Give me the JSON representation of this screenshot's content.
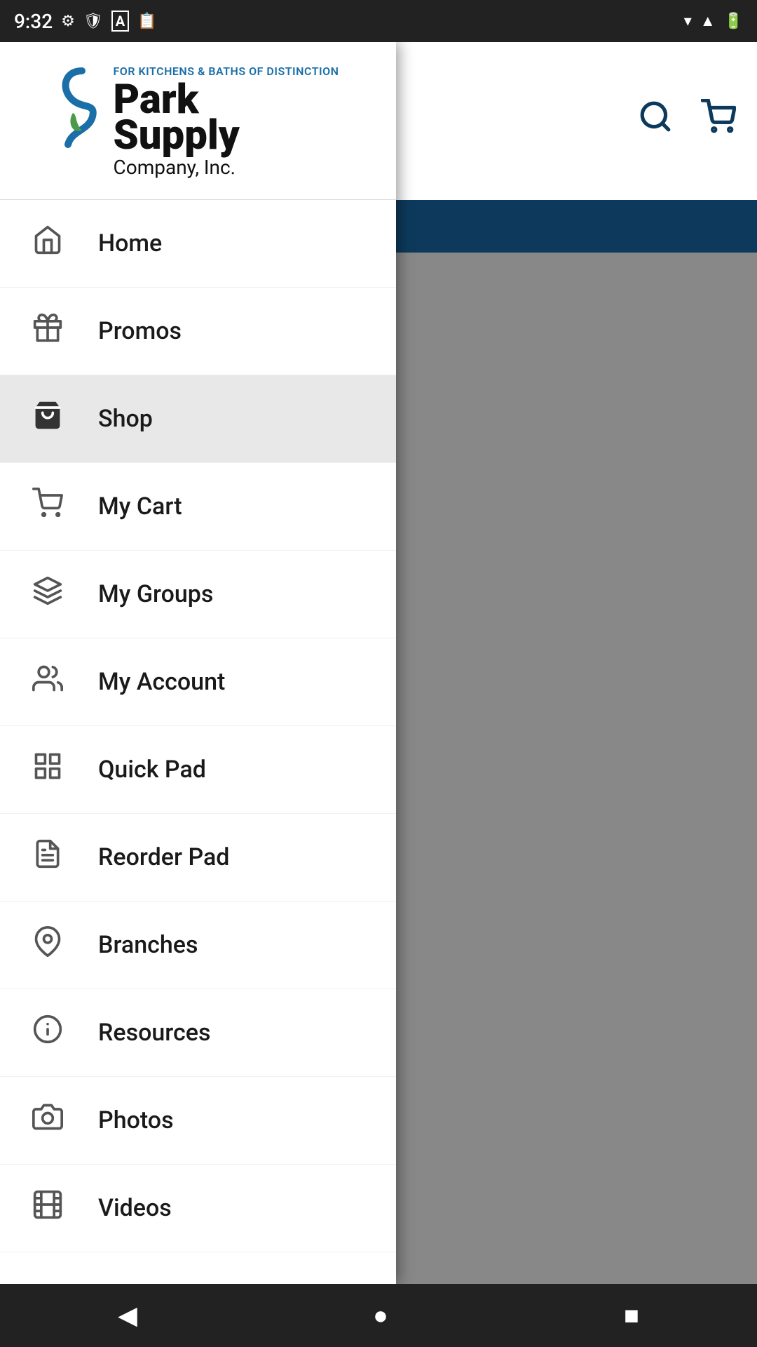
{
  "statusBar": {
    "time": "9:32",
    "icons": [
      "settings",
      "shield",
      "A",
      "clipboard"
    ]
  },
  "header": {
    "searchLabel": "search",
    "cartLabel": "cart"
  },
  "logo": {
    "tagline": "FOR KITCHENS & BATHS OF DISTINCTION",
    "line1": "Park",
    "line2": "Supply",
    "line3": "Company, Inc."
  },
  "menu": {
    "items": [
      {
        "id": "home",
        "label": "Home",
        "icon": "home",
        "active": false
      },
      {
        "id": "promos",
        "label": "Promos",
        "icon": "gift",
        "active": false
      },
      {
        "id": "shop",
        "label": "Shop",
        "icon": "bag",
        "active": true
      },
      {
        "id": "my-cart",
        "label": "My Cart",
        "icon": "cart",
        "active": false
      },
      {
        "id": "my-groups",
        "label": "My Groups",
        "icon": "layers",
        "active": false
      },
      {
        "id": "my-account",
        "label": "My Account",
        "icon": "users",
        "active": false
      },
      {
        "id": "quick-pad",
        "label": "Quick Pad",
        "icon": "grid",
        "active": false
      },
      {
        "id": "reorder-pad",
        "label": "Reorder Pad",
        "icon": "file",
        "active": false
      },
      {
        "id": "branches",
        "label": "Branches",
        "icon": "location",
        "active": false
      },
      {
        "id": "resources",
        "label": "Resources",
        "icon": "info",
        "active": false
      },
      {
        "id": "photos",
        "label": "Photos",
        "icon": "camera",
        "active": false
      },
      {
        "id": "videos",
        "label": "Videos",
        "icon": "film",
        "active": false
      }
    ]
  },
  "navBar": {
    "back": "◀",
    "home": "●",
    "recent": "■"
  }
}
